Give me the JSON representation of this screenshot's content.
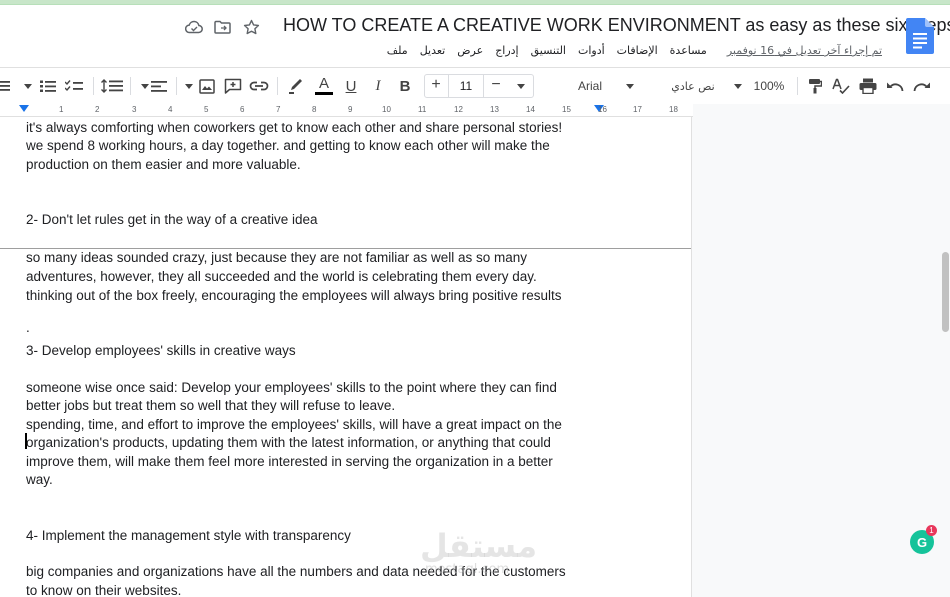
{
  "header": {
    "title": "HOW TO CREATE A CREATIVE WORK ENVIRONMENT as easy as these six steps",
    "last_edit": "تم إجراء آخر تعديل في 16 نوفمبر",
    "menu": [
      "ملف",
      "تعديل",
      "عرض",
      "إدراج",
      "التنسيق",
      "أدوات",
      "الإضافات",
      "مساعدة"
    ]
  },
  "toolbar": {
    "font_name": "Arial",
    "style_name": "نص عادي",
    "zoom": "100%",
    "font_size": "11",
    "plus": "+",
    "minus": "−",
    "bold": "B",
    "italic": "I",
    "underline": "U",
    "text_color": "A"
  },
  "ruler": {
    "labels": [
      "1",
      "2",
      "3",
      "4",
      "5",
      "6",
      "7",
      "8",
      "9",
      "10",
      "11",
      "12",
      "13",
      "14",
      "15",
      "16",
      "17",
      "18"
    ]
  },
  "document": {
    "p1_l1": "it's always comforting when coworkers get to know each other and share personal stories!",
    "p1_l2": "we spend 8 working hours, a day together. and getting to know each other will make the",
    "p1_l3": "production on them easier and more valuable.",
    "h2": "2-  Don't let rules get in the way of a creative idea",
    "p2_l1": "so many ideas sounded crazy, just because they are not familiar as well as so many",
    "p2_l2": "adventures, however, they all succeeded and the world is celebrating them every day.",
    "p2_l3": "thinking out of the box freely, encouraging  the employees will always bring positive results",
    "p2_dot": ".",
    "h3": "3-  Develop employees' skills in creative ways",
    "p3_l1": "someone wise once said: Develop your employees' skills to the point where they can find",
    "p3_l2": "better jobs but treat them so well that they will refuse to leave.",
    "p3_l3": "spending, time, and effort to improve the employees' skills, will have a great impact on the",
    "p3_l4": "organization's products, updating them with the latest information, or anything that could",
    "p3_l5": "improve them, will make them feel more interested in serving the organization in a better",
    "p3_l6": "way.",
    "h4": "4-  Implement the management style with transparency",
    "p4_l1": "big companies and organizations have all the numbers and data needed for the customers",
    "p4_l2": "to know on their websites."
  },
  "watermark": {
    "main": "مستقل",
    "sub": "mostaql.com"
  },
  "grammarly": {
    "letter": "G",
    "count": "1"
  }
}
